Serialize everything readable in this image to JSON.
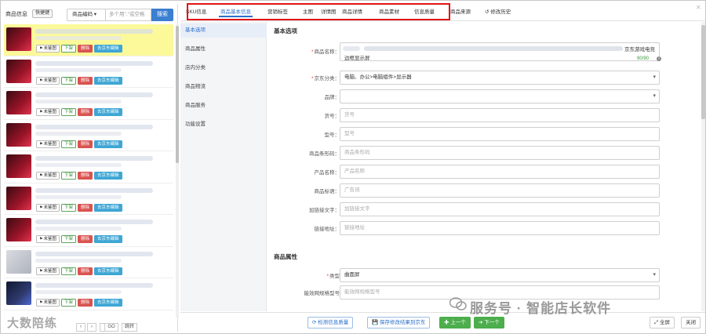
{
  "left_panel": {
    "title": "商品信息",
    "quick_button": "快捷键",
    "search_select": "商品编码 ▾",
    "search_placeholder": "多个用\",\"或空格",
    "search_button": "搜索",
    "item_actions": {
      "flag": "未鉴图",
      "off_shelf": "下架",
      "delete": "删除",
      "jd_edit": "去京东编辑"
    },
    "items": [
      {
        "thumb": "red",
        "active": true
      },
      {
        "thumb": "red",
        "active": false
      },
      {
        "thumb": "red",
        "active": false
      },
      {
        "thumb": "red",
        "active": false
      },
      {
        "thumb": "red",
        "active": false
      },
      {
        "thumb": "red",
        "active": false
      },
      {
        "thumb": "red",
        "active": false
      },
      {
        "thumb": "light",
        "active": false
      },
      {
        "thumb": "dark",
        "active": false
      }
    ],
    "pager": {
      "go_label": "GO",
      "jump_label": "跳转"
    },
    "watermark": "大数陪练"
  },
  "tabs": [
    {
      "label": "SKU信息",
      "active": false
    },
    {
      "label": "商品基本信息",
      "active": true
    },
    {
      "label": "营销标签",
      "active": false
    },
    {
      "label": "主图",
      "active": false
    },
    {
      "label": "详情图",
      "active": false
    },
    {
      "label": "商品详情",
      "active": false
    },
    {
      "label": "商品素材",
      "active": false
    },
    {
      "label": "信息质量",
      "active": false
    },
    {
      "label": "商品来源",
      "active": false
    },
    {
      "label": "修改历史",
      "active": false
    }
  ],
  "sidenav": [
    {
      "label": "基本选项",
      "active": true
    },
    {
      "label": "商品属性",
      "active": false
    },
    {
      "label": "店内分类",
      "active": false
    },
    {
      "label": "商品物流",
      "active": false
    },
    {
      "label": "商品服务",
      "active": false
    },
    {
      "label": "功能设置",
      "active": false
    }
  ],
  "form": {
    "section_basic": "基本选项",
    "name_label": "商品名称：",
    "name_tail": "京东游戏电竞",
    "name_line2": "边框显示屏",
    "name_count": "90/90",
    "fields": [
      {
        "label": "京东分类：",
        "value": "电脑、办公>电脑组件>显示器",
        "placeholder": "",
        "required": true,
        "select": true
      },
      {
        "label": "品牌：",
        "value": "",
        "placeholder": "",
        "required": false,
        "select": true
      },
      {
        "label": "货号：",
        "value": "",
        "placeholder": "货号",
        "required": false,
        "select": false
      },
      {
        "label": "型号：",
        "value": "",
        "placeholder": "型号",
        "required": false,
        "select": false
      },
      {
        "label": "商品条形码：",
        "value": "",
        "placeholder": "商品条形码",
        "required": false,
        "select": false
      },
      {
        "label": "产品名称：",
        "value": "",
        "placeholder": "产品名称",
        "required": false,
        "select": false
      },
      {
        "label": "商品标语：",
        "value": "",
        "placeholder": "广告词",
        "required": false,
        "select": false
      },
      {
        "label": "加链接文字：",
        "value": "",
        "placeholder": "加链接文字",
        "required": false,
        "select": false
      },
      {
        "label": "链接地址：",
        "value": "",
        "placeholder": "链接地址",
        "required": false,
        "select": false
      }
    ],
    "section_attrs": "商品属性",
    "attr_fields": [
      {
        "label": "类型",
        "value": "曲面屏",
        "placeholder": "",
        "required": true,
        "select": true
      },
      {
        "label": "能效网规格型号",
        "value": "",
        "placeholder": "能效网规格型号",
        "required": false,
        "select": false
      }
    ]
  },
  "bottom_bar": {
    "check_quality": "检测信息质量",
    "save_to_jd": "保存修改结果到京东",
    "prev": "上一个",
    "next": "下一个",
    "fullscreen": "全屏",
    "close": "关闭"
  },
  "watermark_right": "服务号 · 智能店长软件",
  "colors": {
    "accent": "#2a6fc9",
    "highlight_box": "#e01515",
    "active_item": "#fbf99a",
    "delete": "#d9534f",
    "jd": "#3ea6d4",
    "green": "#4cae4c"
  }
}
